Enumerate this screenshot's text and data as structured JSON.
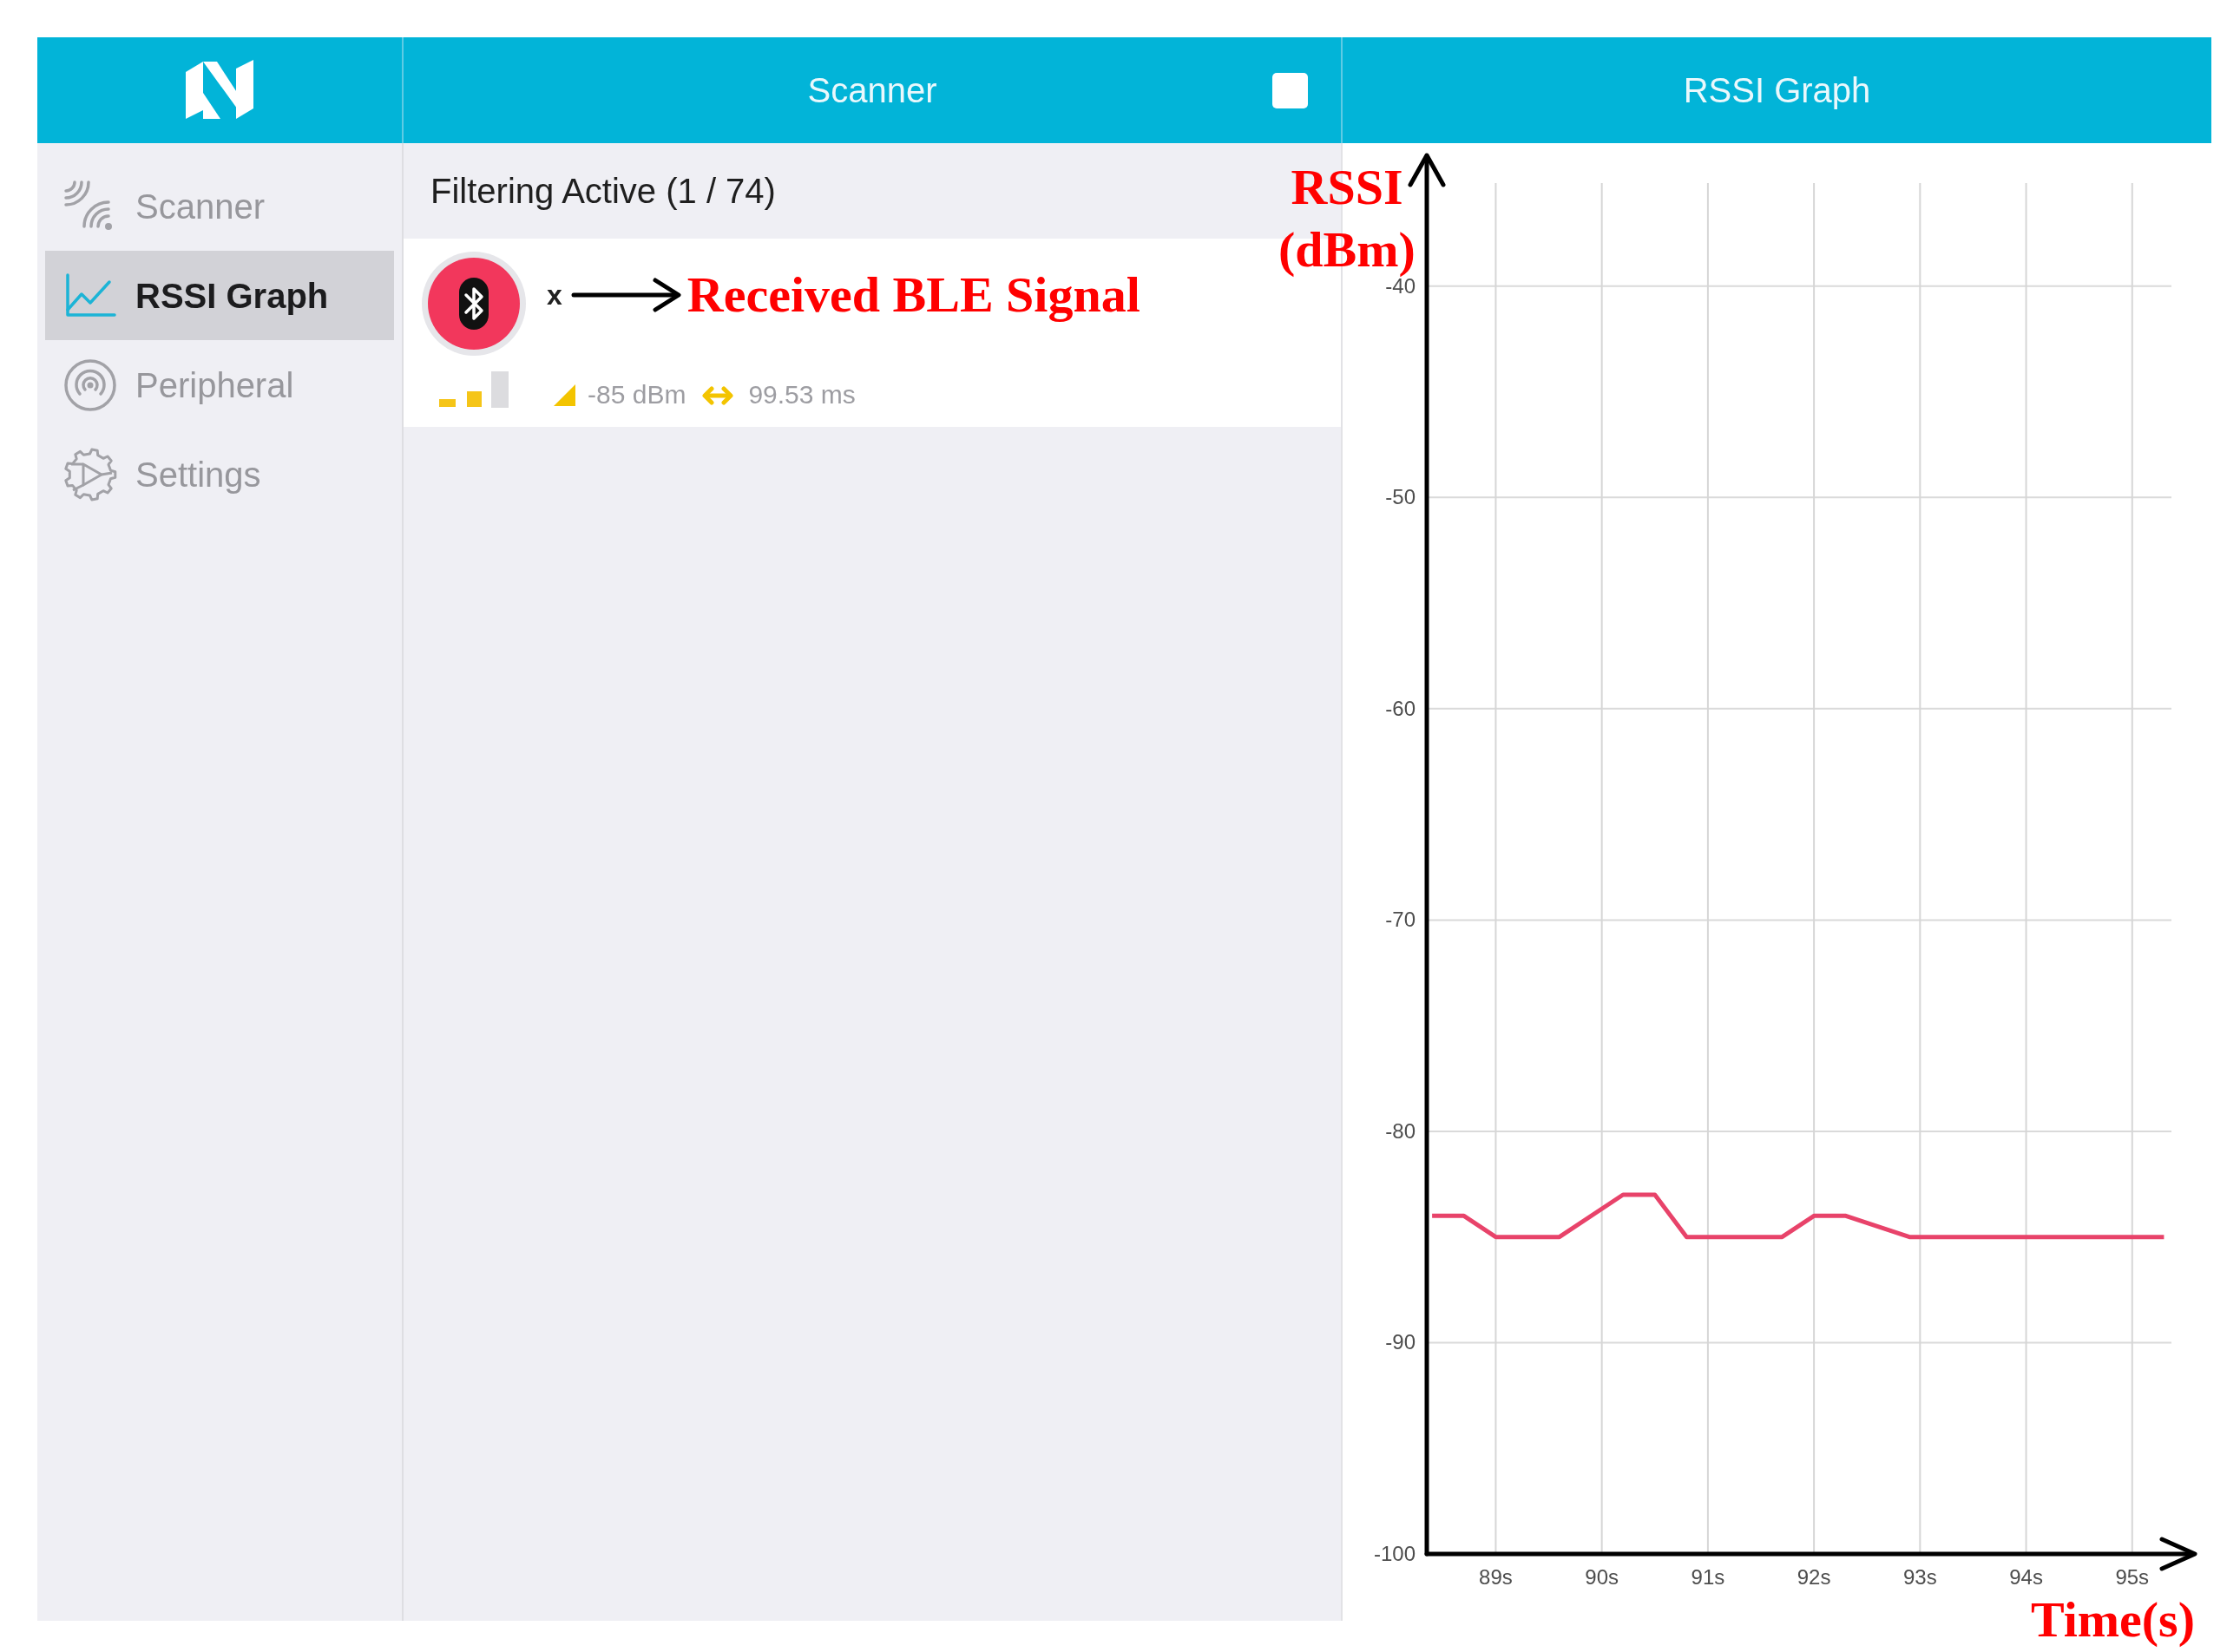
{
  "sidebar": {
    "items": [
      {
        "label": "Scanner",
        "selected": false
      },
      {
        "label": "RSSI Graph",
        "selected": true
      },
      {
        "label": "Peripheral",
        "selected": false
      },
      {
        "label": "Settings",
        "selected": false
      }
    ]
  },
  "scanner": {
    "title": "Scanner",
    "filter_status": "Filtering Active (1 / 74)",
    "devices": [
      {
        "name": "x",
        "annotation": "Received BLE Signal",
        "rssi": "-85 dBm",
        "interval": "99.53 ms"
      }
    ]
  },
  "rssi_graph": {
    "title": "RSSI Graph",
    "chart_data": {
      "type": "line",
      "xlabel": "Time(s)",
      "ylabel": "RSSI (dBm)",
      "grid": true,
      "x": [
        88.4,
        88.7,
        89.0,
        89.6,
        90.2,
        90.5,
        90.8,
        91.7,
        92.0,
        92.3,
        92.9,
        95.3
      ],
      "values": [
        -84,
        -84,
        -85,
        -85,
        -83,
        -83,
        -85,
        -85,
        -84,
        -84,
        -85,
        -85
      ],
      "xlim": [
        88.35,
        95.37
      ],
      "ylim": [
        -100,
        -35
      ],
      "xticks": [
        {
          "value": 89,
          "label": "89s"
        },
        {
          "value": 90,
          "label": "90s"
        },
        {
          "value": 91,
          "label": "91s"
        },
        {
          "value": 92,
          "label": "92s"
        },
        {
          "value": 93,
          "label": "93s"
        },
        {
          "value": 94,
          "label": "94s"
        },
        {
          "value": 95,
          "label": "95s"
        }
      ],
      "yticks": [
        -40,
        -50,
        -60,
        -70,
        -80,
        -90,
        -100
      ]
    }
  }
}
